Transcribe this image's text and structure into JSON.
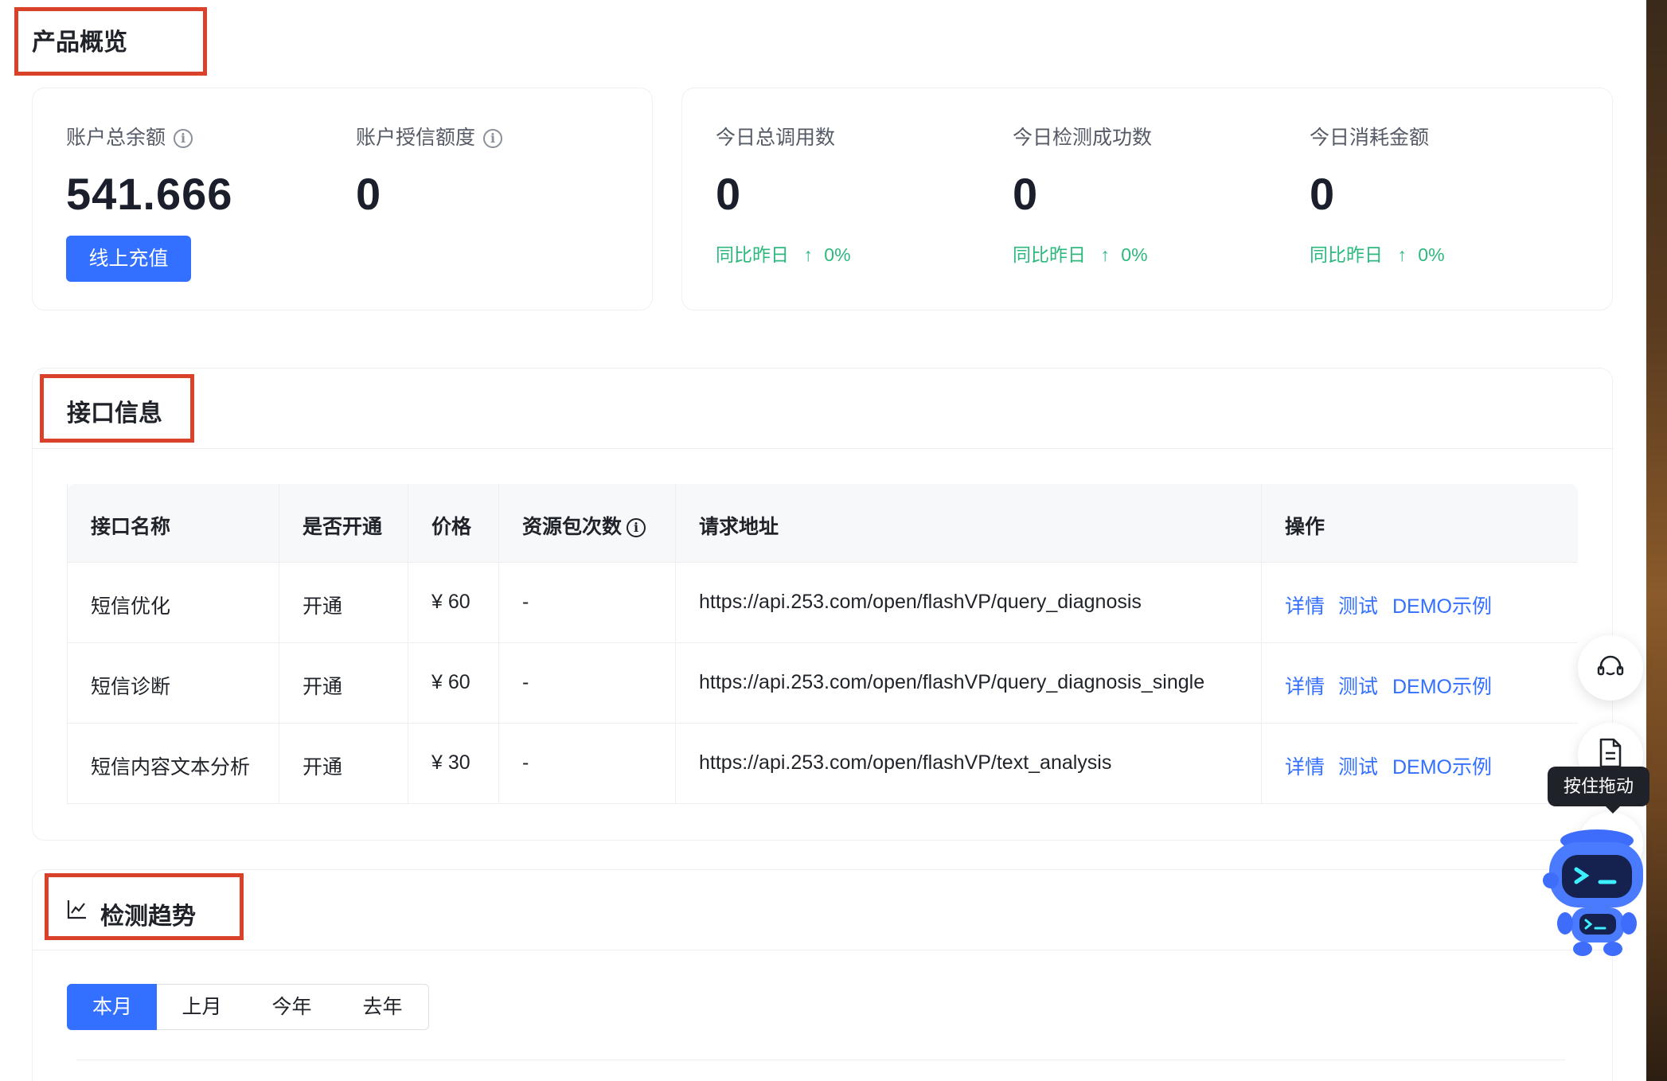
{
  "overview": {
    "title": "产品概览",
    "balance": {
      "label": "账户总余额",
      "value": "541.666",
      "recharge_button": "线上充值"
    },
    "credit": {
      "label": "账户授信额度",
      "value": "0"
    },
    "today": [
      {
        "label": "今日总调用数",
        "value": "0",
        "compare_label": "同比昨日",
        "change": "0%"
      },
      {
        "label": "今日检测成功数",
        "value": "0",
        "compare_label": "同比昨日",
        "change": "0%"
      },
      {
        "label": "今日消耗金额",
        "value": "0",
        "compare_label": "同比昨日",
        "change": "0%"
      }
    ]
  },
  "api_info": {
    "title": "接口信息",
    "columns": [
      "接口名称",
      "是否开通",
      "价格",
      "资源包次数",
      "请求地址",
      "操作"
    ],
    "rows": [
      {
        "name": "短信优化",
        "status": "开通",
        "price": "¥ 60",
        "package": "-",
        "url": "https://api.253.com/open/flashVP/query_diagnosis"
      },
      {
        "name": "短信诊断",
        "status": "开通",
        "price": "¥ 60",
        "package": "-",
        "url": "https://api.253.com/open/flashVP/query_diagnosis_single"
      },
      {
        "name": "短信内容文本分析",
        "status": "开通",
        "price": "¥ 30",
        "package": "-",
        "url": "https://api.253.com/open/flashVP/text_analysis"
      }
    ],
    "actions": [
      "详情",
      "测试",
      "DEMO示例"
    ]
  },
  "trend": {
    "title": "检测趋势",
    "tabs": [
      "本月",
      "上月",
      "今年",
      "去年"
    ],
    "active_tab": "本月"
  },
  "float_tools": {
    "drag_tooltip": "按住拖动",
    "support_icon": "headset-icon",
    "doc_icon": "document-icon",
    "assistant_icon": "robot-assistant-icon"
  },
  "colors": {
    "primary": "#3370ff",
    "success": "#2db87d",
    "annotation": "#d9412b"
  }
}
